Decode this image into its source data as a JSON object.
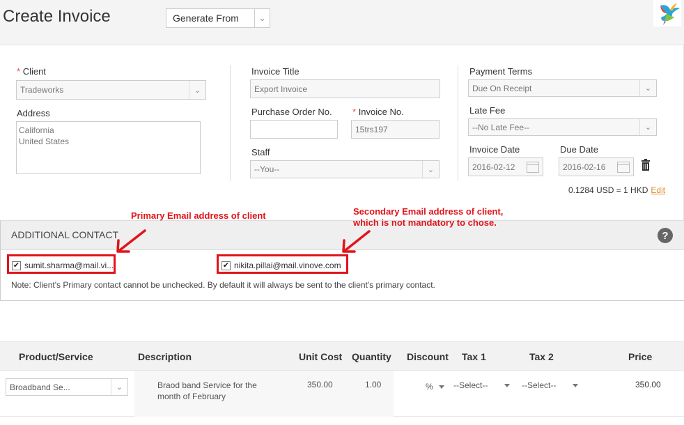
{
  "header": {
    "title": "Create Invoice",
    "generate_from": "Generate From"
  },
  "client": {
    "label": "Client",
    "required_mark": "*",
    "value": "Tradeworks"
  },
  "address": {
    "label": "Address",
    "line1": "California",
    "line2": "United States"
  },
  "invoice_title": {
    "label": "Invoice Title",
    "value": "Export Invoice"
  },
  "purchase_order": {
    "label": "Purchase Order No.",
    "value": ""
  },
  "invoice_no": {
    "label": "Invoice No.",
    "required_mark": "*",
    "value": "15trs197"
  },
  "staff": {
    "label": "Staff",
    "value": "--You--"
  },
  "payment_terms": {
    "label": "Payment Terms",
    "value": "Due On Receipt"
  },
  "late_fee": {
    "label": "Late Fee",
    "value": "--No Late Fee--"
  },
  "invoice_date": {
    "label": "Invoice Date",
    "value": "2016-02-12"
  },
  "due_date": {
    "label": "Due Date",
    "value": "2016-02-16"
  },
  "exchange": {
    "rate": "0.1284 USD = 1 HKD",
    "edit": "Edit"
  },
  "additional_contact": {
    "title": "ADDITIONAL CONTACT",
    "help": "?",
    "primary_email": "sumit.sharma@mail.vi...",
    "secondary_email": "nikita.pillai@mail.vinove.com",
    "check_mark": "✔",
    "note": "Note: Client's Primary contact cannot be unchecked. By default it will always be sent to the client's primary contact."
  },
  "annotations": {
    "primary": "Primary Email address of client",
    "secondary_line1": "Secondary Email address of client,",
    "secondary_line2": "which is not mandatory to chose."
  },
  "table": {
    "headers": [
      "Product/Service",
      "Description",
      "Unit Cost",
      "Quantity",
      "Discount",
      "Tax 1",
      "Tax 2",
      "Price"
    ],
    "rows": [
      {
        "product": "Broadband Se...",
        "description_line1": "Braod band Service for the",
        "description_line2": "month of February",
        "unit_cost": "350.00",
        "quantity": "1.00",
        "discount": "%",
        "tax1": "--Select--",
        "tax2": "--Select--",
        "price": "350.00"
      }
    ]
  },
  "colors": {
    "annotation_red": "#e0141b",
    "edit_link": "#e08a2a"
  }
}
